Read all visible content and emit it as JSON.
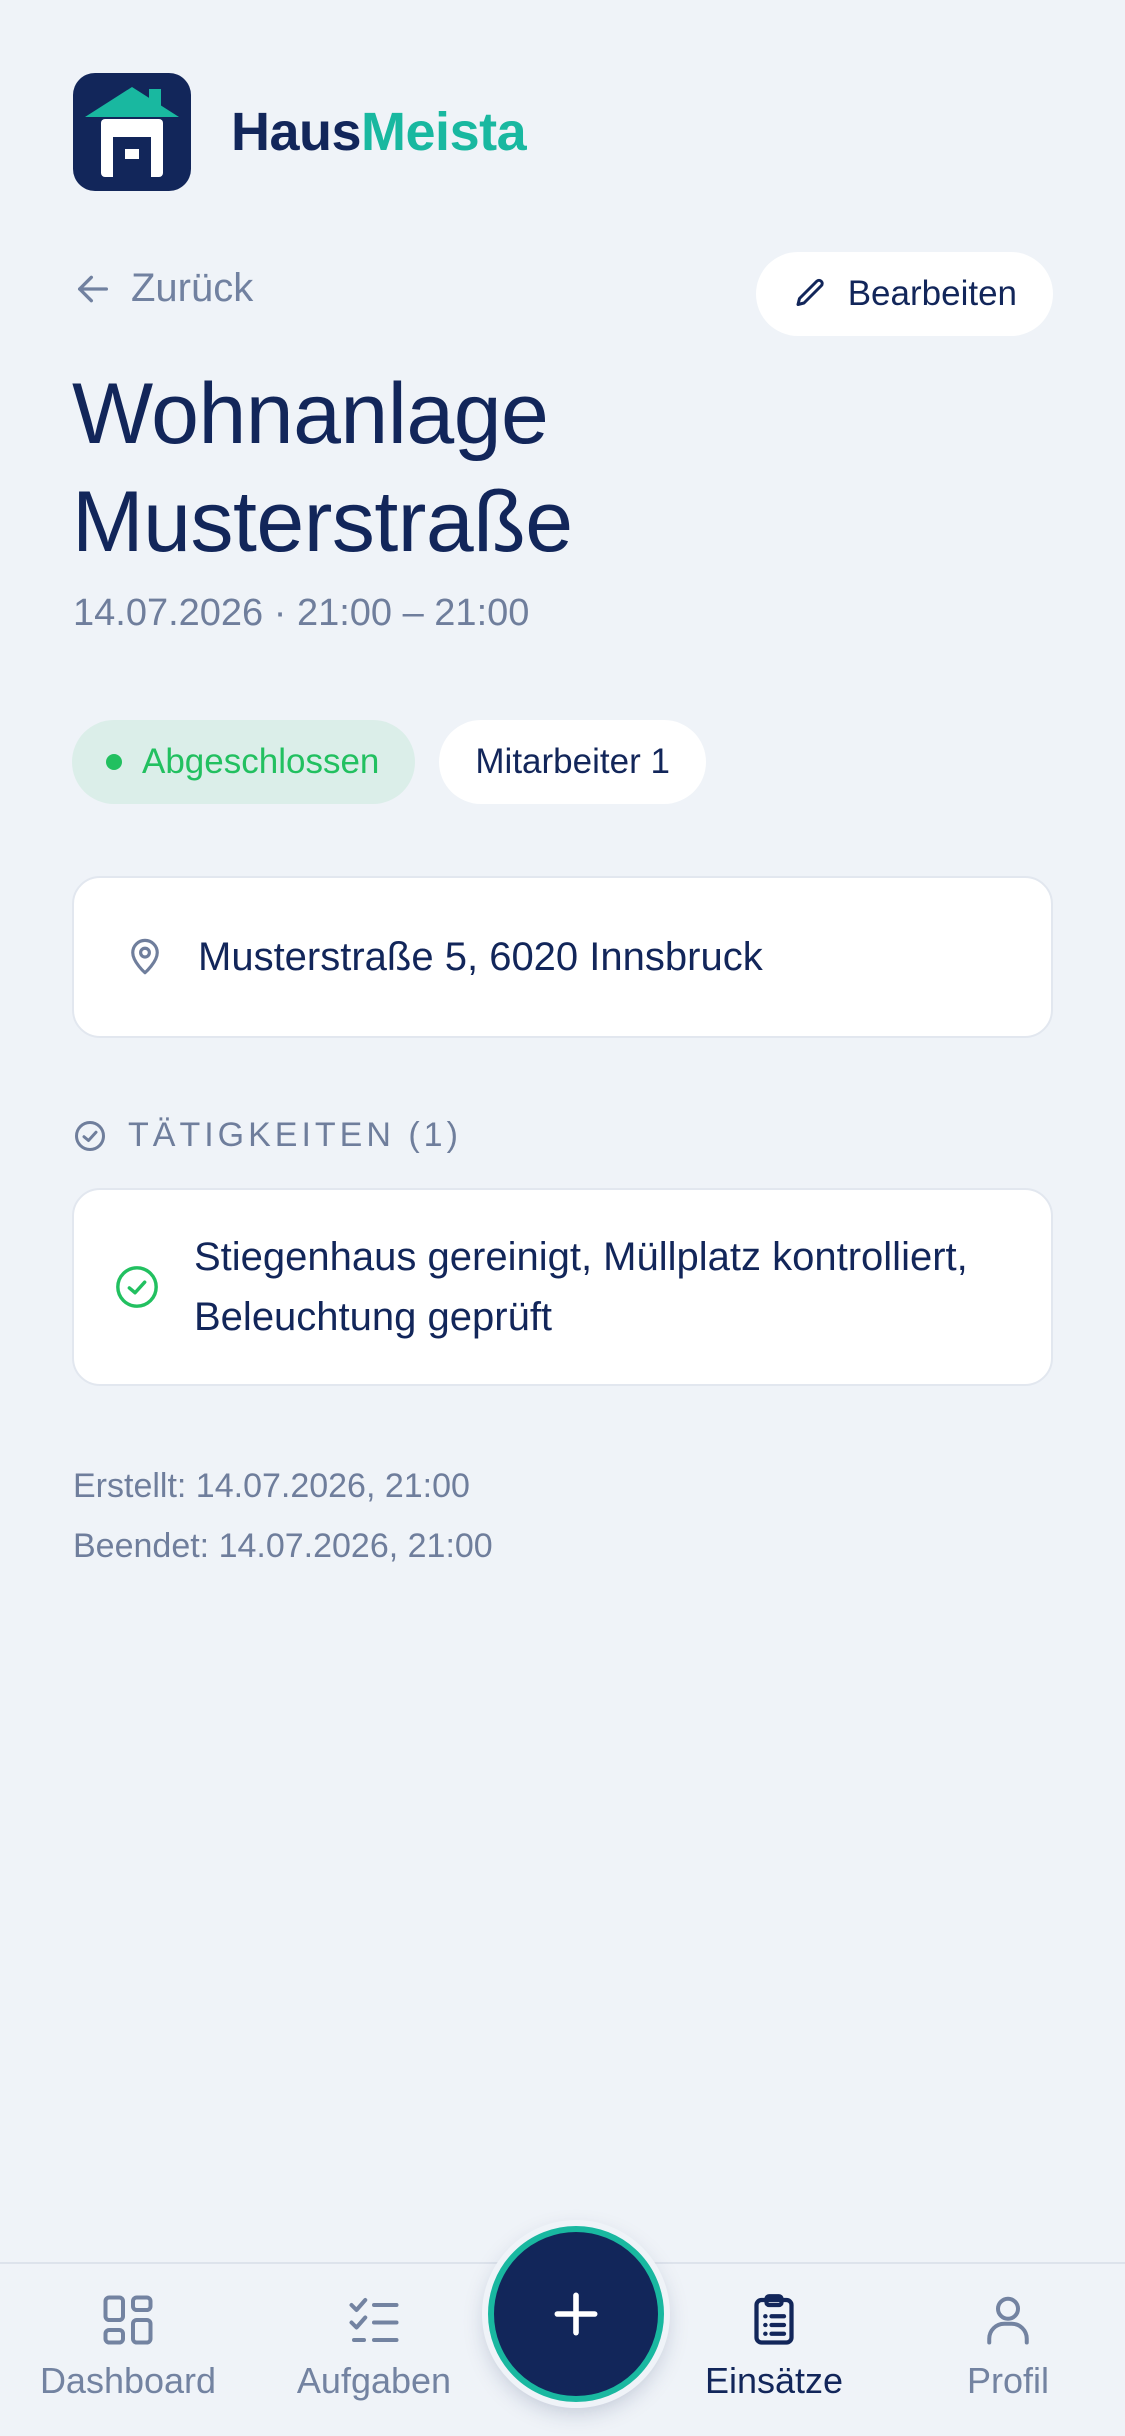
{
  "brand": {
    "name_part_a": "Haus",
    "name_part_b": "Meista",
    "logo_icon": "house-h-logo"
  },
  "nav_top": {
    "back_label": "Zurück",
    "edit_label": "Bearbeiten"
  },
  "assignment": {
    "title": "Wohnanlage Musterstraße",
    "datetime": "14.07.2026 · 21:00 – 21:00",
    "status": "Abgeschlossen",
    "staff": "Mitarbeiter 1",
    "address": "Musterstraße 5, 6020 Innsbruck"
  },
  "tasks_section": {
    "heading": "TÄTIGKEITEN (1)",
    "items": [
      {
        "text": "Stiegenhaus gereinigt, Müllplatz kontrolliert, Beleuchtung geprüft",
        "done": true
      }
    ]
  },
  "meta": {
    "created": "Erstellt: 14.07.2026, 21:00",
    "ended": "Beendet: 14.07.2026, 21:00"
  },
  "bottom_nav": {
    "items": [
      {
        "label": "Dashboard",
        "icon": "grid-icon"
      },
      {
        "label": "Aufgaben",
        "icon": "checklist-icon"
      },
      {
        "label": "Einsätze",
        "icon": "clipboard-icon",
        "active": true
      },
      {
        "label": "Profil",
        "icon": "user-icon"
      }
    ],
    "fab_icon": "plus-icon"
  },
  "colors": {
    "navy": "#12265a",
    "teal": "#19b8a0",
    "success": "#22c060",
    "muted": "#6f7e9c",
    "background": "#eff3f8"
  }
}
